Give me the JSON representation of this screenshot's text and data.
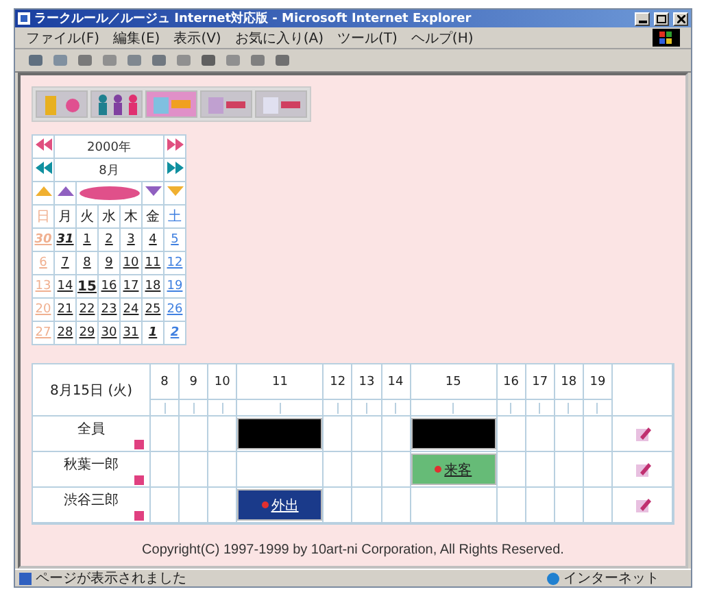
{
  "window": {
    "title": "ラークルール／ルージュ Internet対応版 - Microsoft Internet Explorer"
  },
  "menu": [
    "ファイル(F)",
    "編集(E)",
    "表示(V)",
    "お気に入り(A)",
    "ツール(T)",
    "ヘルプ(H)"
  ],
  "nav_tabs": [
    {
      "kind": "door",
      "selected": false
    },
    {
      "kind": "people",
      "selected": false
    },
    {
      "kind": "day",
      "selected": true
    },
    {
      "kind": "week",
      "selected": false
    },
    {
      "kind": "month",
      "selected": false
    }
  ],
  "calendar": {
    "year": "2000年",
    "month": "8月",
    "weekdays": [
      "日",
      "月",
      "火",
      "水",
      "木",
      "金",
      "土"
    ],
    "weeks": [
      [
        {
          "day": "30",
          "other_month": true,
          "selected": false
        },
        {
          "day": "31",
          "other_month": true,
          "selected": false
        },
        {
          "day": "1",
          "other_month": false,
          "selected": false
        },
        {
          "day": "2",
          "other_month": false,
          "selected": false
        },
        {
          "day": "3",
          "other_month": false,
          "selected": false
        },
        {
          "day": "4",
          "other_month": false,
          "selected": false
        },
        {
          "day": "5",
          "other_month": false,
          "selected": false
        }
      ],
      [
        {
          "day": "6",
          "other_month": false,
          "selected": false
        },
        {
          "day": "7",
          "other_month": false,
          "selected": false
        },
        {
          "day": "8",
          "other_month": false,
          "selected": false
        },
        {
          "day": "9",
          "other_month": false,
          "selected": false
        },
        {
          "day": "10",
          "other_month": false,
          "selected": false
        },
        {
          "day": "11",
          "other_month": false,
          "selected": false
        },
        {
          "day": "12",
          "other_month": false,
          "selected": false
        }
      ],
      [
        {
          "day": "13",
          "other_month": false,
          "selected": false
        },
        {
          "day": "14",
          "other_month": false,
          "selected": false
        },
        {
          "day": "15",
          "other_month": false,
          "selected": true
        },
        {
          "day": "16",
          "other_month": false,
          "selected": false
        },
        {
          "day": "17",
          "other_month": false,
          "selected": false
        },
        {
          "day": "18",
          "other_month": false,
          "selected": false
        },
        {
          "day": "19",
          "other_month": false,
          "selected": false
        }
      ],
      [
        {
          "day": "20",
          "other_month": false,
          "selected": false
        },
        {
          "day": "21",
          "other_month": false,
          "selected": false
        },
        {
          "day": "22",
          "other_month": false,
          "selected": false
        },
        {
          "day": "23",
          "other_month": false,
          "selected": false
        },
        {
          "day": "24",
          "other_month": false,
          "selected": false
        },
        {
          "day": "25",
          "other_month": false,
          "selected": false
        },
        {
          "day": "26",
          "other_month": false,
          "selected": false
        }
      ],
      [
        {
          "day": "27",
          "other_month": false,
          "selected": false
        },
        {
          "day": "28",
          "other_month": false,
          "selected": false
        },
        {
          "day": "29",
          "other_month": false,
          "selected": false
        },
        {
          "day": "30",
          "other_month": false,
          "selected": false
        },
        {
          "day": "31",
          "other_month": false,
          "selected": false
        },
        {
          "day": "1",
          "other_month": true,
          "selected": false
        },
        {
          "day": "2",
          "other_month": true,
          "selected": false
        }
      ]
    ]
  },
  "schedule": {
    "date": "8月15日 (火)",
    "hours": [
      "8",
      "9",
      "10",
      "11",
      "12",
      "13",
      "14",
      "15",
      "16",
      "17",
      "18",
      "19"
    ],
    "rows": [
      {
        "name": "全員",
        "slots": [
          {
            "kind": "empty"
          },
          {
            "kind": "empty"
          },
          {
            "kind": "empty"
          },
          {
            "kind": "busy"
          },
          {
            "kind": "empty"
          },
          {
            "kind": "empty"
          },
          {
            "kind": "empty"
          },
          {
            "kind": "busy"
          },
          {
            "kind": "empty"
          },
          {
            "kind": "empty"
          },
          {
            "kind": "empty"
          },
          {
            "kind": "empty"
          }
        ]
      },
      {
        "name": "秋葉一郎",
        "slots": [
          {
            "kind": "empty"
          },
          {
            "kind": "empty"
          },
          {
            "kind": "empty"
          },
          {
            "kind": "empty"
          },
          {
            "kind": "empty"
          },
          {
            "kind": "empty"
          },
          {
            "kind": "empty"
          },
          {
            "kind": "event",
            "label": "来客",
            "color": "#66bb77"
          },
          {
            "kind": "empty"
          },
          {
            "kind": "empty"
          },
          {
            "kind": "empty"
          },
          {
            "kind": "empty"
          }
        ]
      },
      {
        "name": "渋谷三郎",
        "slots": [
          {
            "kind": "empty"
          },
          {
            "kind": "empty"
          },
          {
            "kind": "empty"
          },
          {
            "kind": "event",
            "label": "外出",
            "color": "#1a3a8a"
          },
          {
            "kind": "empty"
          },
          {
            "kind": "empty"
          },
          {
            "kind": "empty"
          },
          {
            "kind": "empty"
          },
          {
            "kind": "empty"
          },
          {
            "kind": "empty"
          },
          {
            "kind": "empty"
          },
          {
            "kind": "empty"
          }
        ]
      }
    ]
  },
  "footer": "Copyright(C) 1997-1999 by 10art-ni Corporation, All Rights Reserved.",
  "status_bar": {
    "message": "ページが表示されました",
    "zone": "インターネット"
  }
}
